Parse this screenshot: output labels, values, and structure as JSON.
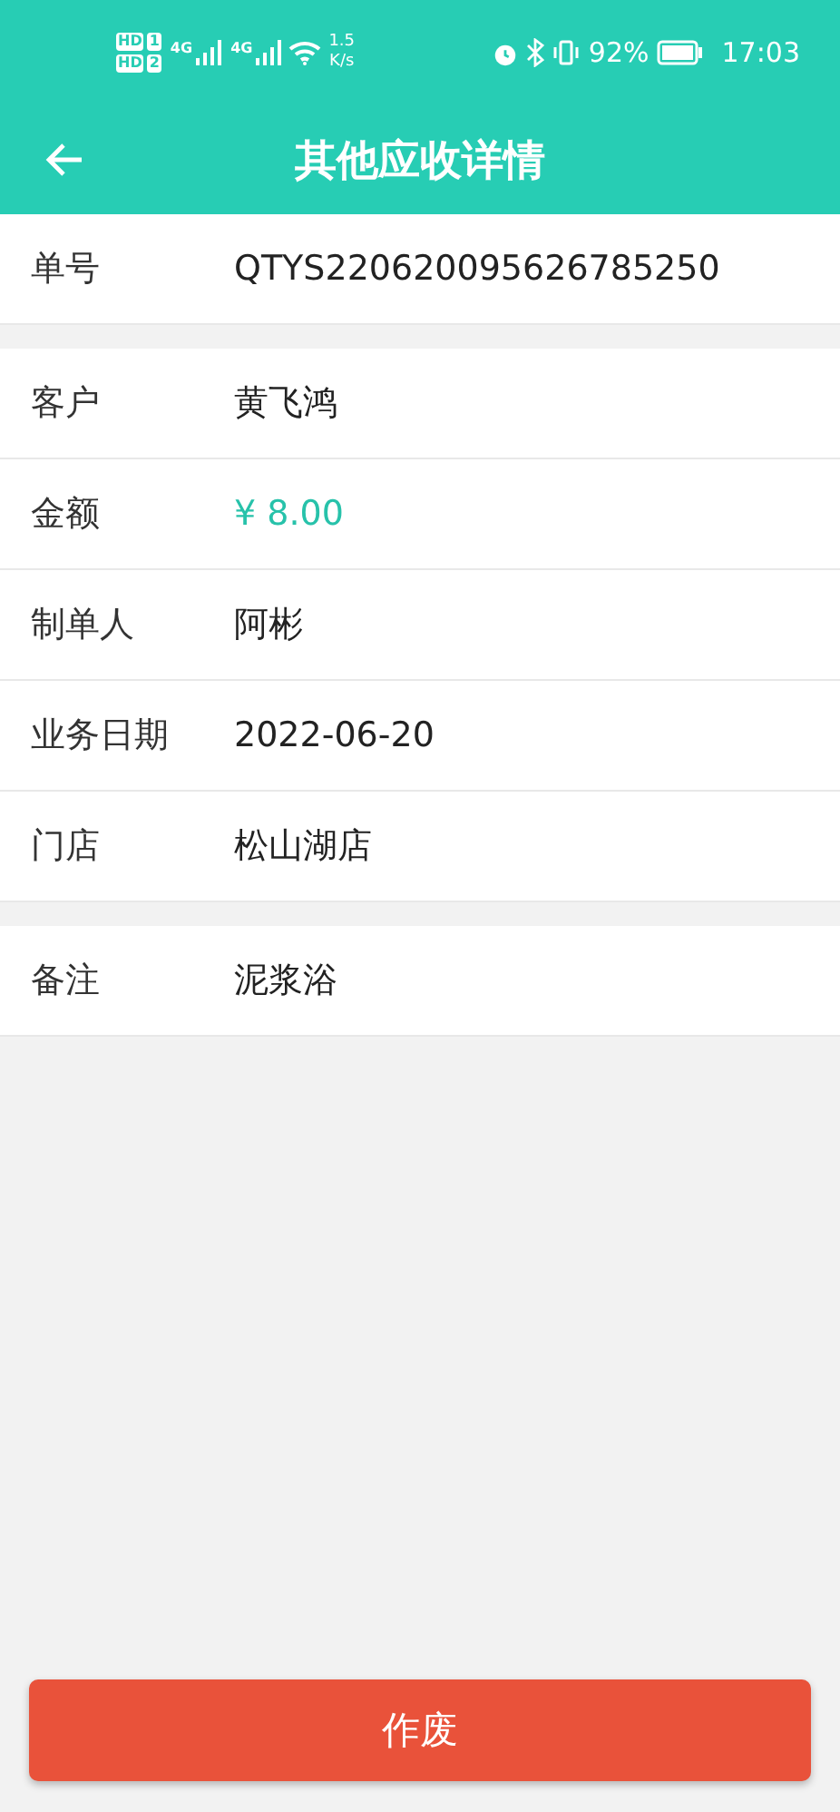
{
  "status_bar": {
    "sims": [
      {
        "badge": "HD",
        "slot": "1"
      },
      {
        "badge": "HD",
        "slot": "2"
      }
    ],
    "networks": [
      "4G",
      "4G"
    ],
    "speed": {
      "value": "1.5",
      "unit": "K/s"
    },
    "battery": "92%",
    "time": "17:03"
  },
  "header": {
    "title": "其他应收详情"
  },
  "groups": [
    {
      "rows": [
        {
          "label": "单号",
          "value": "QTYS220620095626785250",
          "kind": "text"
        }
      ]
    },
    {
      "rows": [
        {
          "label": "客户",
          "value": "黄飞鸿",
          "kind": "text"
        },
        {
          "label": "金额",
          "value": "¥ 8.00",
          "kind": "amount"
        },
        {
          "label": "制单人",
          "value": "阿彬",
          "kind": "text"
        },
        {
          "label": "业务日期",
          "value": "2022-06-20",
          "kind": "text"
        },
        {
          "label": "门店",
          "value": "松山湖店",
          "kind": "text"
        }
      ]
    },
    {
      "rows": [
        {
          "label": "备注",
          "value": "泥浆浴",
          "kind": "text"
        }
      ]
    }
  ],
  "action": {
    "label": "作废"
  }
}
